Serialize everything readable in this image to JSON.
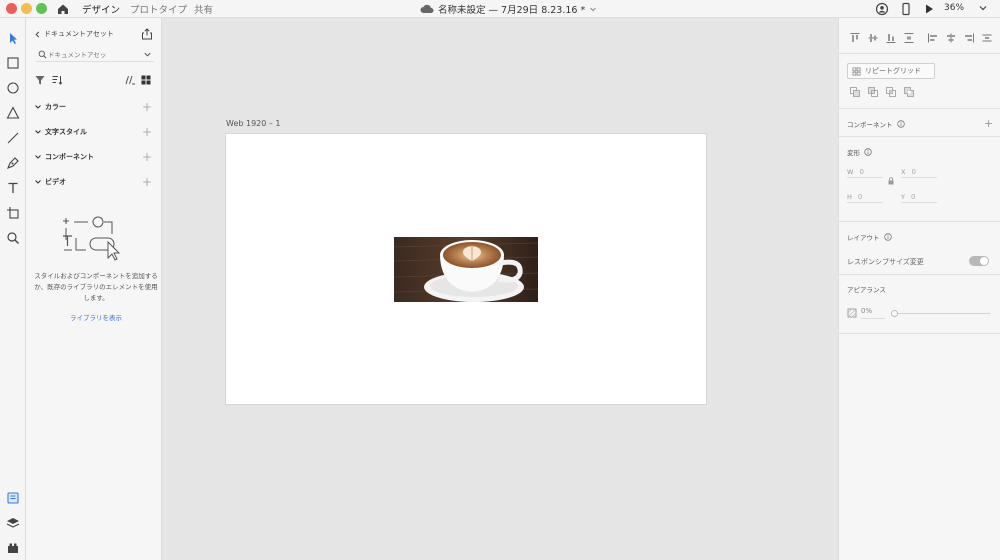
{
  "titlebar": {
    "tabs": [
      {
        "label": "デザイン",
        "active": true
      },
      {
        "label": "プロトタイプ",
        "active": false
      },
      {
        "label": "共有",
        "active": false
      }
    ],
    "document_title": "名称未設定 — 7月29日 8.23.16 *",
    "zoom": "36%"
  },
  "tools": [
    "select-tool-icon",
    "rectangle-tool-icon",
    "ellipse-tool-icon",
    "polygon-tool-icon",
    "line-tool-icon",
    "pen-tool-icon",
    "text-tool-icon",
    "artboard-tool-icon",
    "zoom-tool-icon"
  ],
  "assets": {
    "header": "ドキュメントアセット",
    "search_placeholder": "ドキュメントアセッ",
    "sections": [
      {
        "label": "カラー"
      },
      {
        "label": "文字スタイル"
      },
      {
        "label": "コンポーネント"
      },
      {
        "label": "ビデオ"
      }
    ],
    "empty_message": "スタイルおよびコンポーネントを追加するか、既存のライブラリのエレメントを使用します。",
    "library_link": "ライブラリを表示"
  },
  "canvas": {
    "artboard_label": "Web 1920 – 1"
  },
  "properties": {
    "repeat_grid_label": "リピートグリッド",
    "component_label": "コンポーネント",
    "transform_label": "変形",
    "fields": {
      "w_key": "W",
      "w_value": "0",
      "x_key": "X",
      "x_value": "0",
      "h_key": "H",
      "h_value": "0",
      "y_key": "Y",
      "y_value": "0"
    },
    "layout_label": "レイアウト",
    "responsive_label": "レスポンシブサイズ変更",
    "responsive_on": true,
    "appearance_label": "アピアランス",
    "opacity_value": "0%",
    "opacity_level": 0
  },
  "colors": {
    "accent": "#3b73d6",
    "traffic_red": "#ec5f57",
    "traffic_yellow": "#f3be4e",
    "traffic_green": "#5fc454",
    "panel_bg": "#f6f6f6",
    "canvas_bg": "#e5e5e5"
  }
}
